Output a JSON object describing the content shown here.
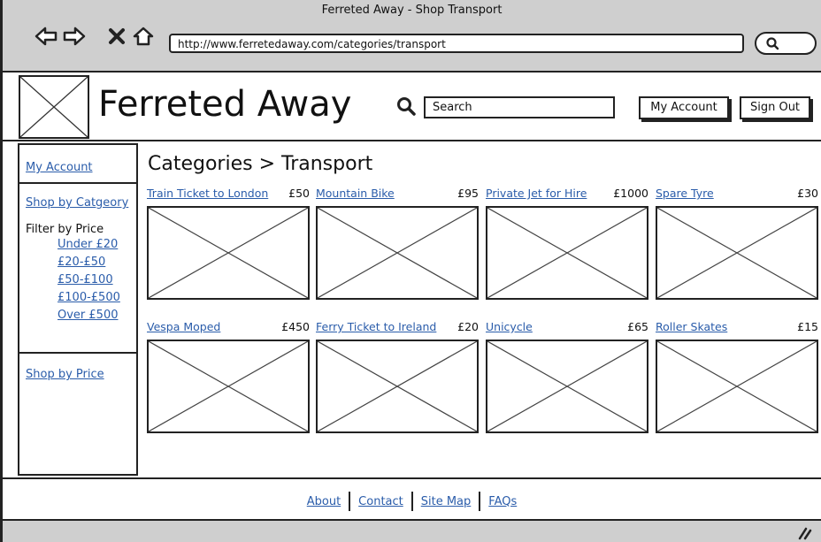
{
  "window": {
    "title": "Ferreted Away - Shop Transport"
  },
  "browser": {
    "url": "http://www.ferretedaway.com/categories/transport"
  },
  "header": {
    "brand": "Ferreted Away",
    "search_placeholder": "Search",
    "my_account": "My Account",
    "sign_out": "Sign Out"
  },
  "sidebar": {
    "my_account": "My Account",
    "shop_by_category": "Shop by Catgeory",
    "filter_by_price": "Filter by Price",
    "price_filters": [
      "Under £20",
      "£20-£50",
      "£50-£100",
      "£100-£500",
      "Over £500"
    ],
    "shop_by_price": "Shop by Price"
  },
  "main": {
    "title": "Categories > Transport",
    "products": [
      {
        "name": "Train Ticket to London",
        "price": "£50"
      },
      {
        "name": "Mountain Bike",
        "price": "£95"
      },
      {
        "name": "Private Jet for Hire",
        "price": "£1000"
      },
      {
        "name": "Spare Tyre",
        "price": "£30"
      },
      {
        "name": "Vespa Moped",
        "price": "£450"
      },
      {
        "name": "Ferry Ticket to Ireland",
        "price": "£20"
      },
      {
        "name": "Unicycle",
        "price": "£65"
      },
      {
        "name": "Roller Skates",
        "price": "£15"
      }
    ]
  },
  "footer": {
    "links": [
      "About",
      "Contact",
      "Site Map",
      "FAQs"
    ]
  }
}
